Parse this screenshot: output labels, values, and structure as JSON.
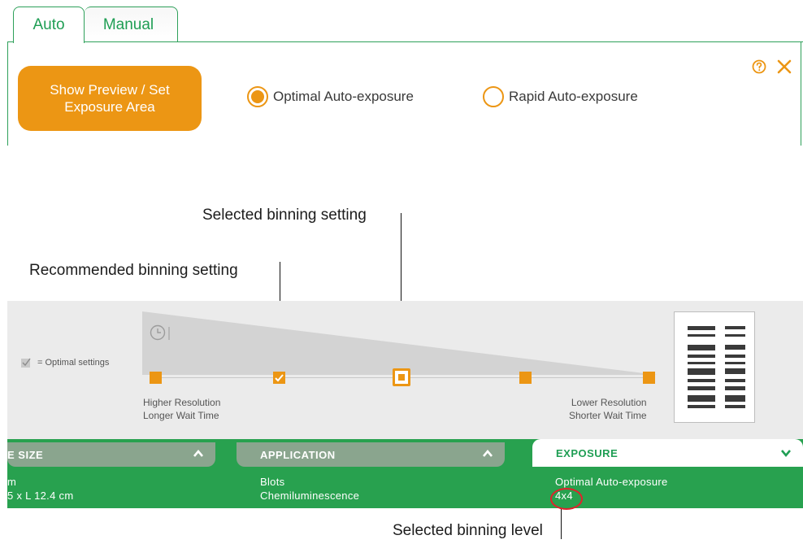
{
  "tabs": {
    "auto": "Auto",
    "manual": "Manual"
  },
  "panel": {
    "preview_button": "Show Preview / Set Exposure Area",
    "radio_optimal": "Optimal Auto-exposure",
    "radio_rapid": "Rapid Auto-exposure",
    "selected_mode": "Optimal Auto-exposure"
  },
  "annotations": {
    "selected_setting": "Selected binning setting",
    "recommended_setting": "Recommended binning setting",
    "selected_level": "Selected binning level"
  },
  "binning": {
    "legend": "= Optimal settings",
    "left_line1": "Higher Resolution",
    "left_line2": "Longer Wait Time",
    "right_line1": "Lower Resolution",
    "right_line2": "Shorter Wait Time",
    "selected_index": 2,
    "recommended_index": 1
  },
  "bottom": {
    "size_head": "E SIZE",
    "size_line1": "m",
    "size_line2": "5 x L 12.4 cm",
    "application_head": "APPLICATION",
    "application_line1": "Blots",
    "application_line2": "Chemiluminescence",
    "exposure_head": "EXPOSURE",
    "exposure_line1": "Optimal Auto-exposure",
    "exposure_line2": "4x4"
  },
  "colors": {
    "accent": "#ec9614",
    "brand_green": "#28a14f",
    "highlight": "#e2202c"
  },
  "icons": [
    "help-icon",
    "close-icon",
    "clock-icon",
    "check-icon",
    "chevron-up-icon",
    "chevron-down-icon"
  ]
}
